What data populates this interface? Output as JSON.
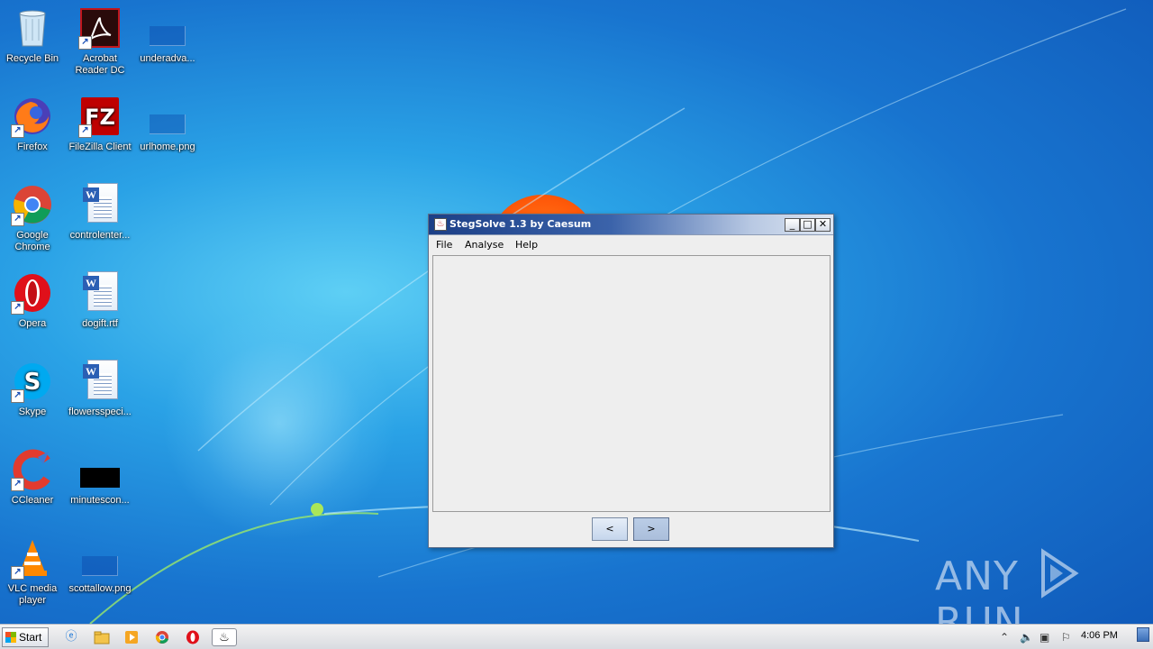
{
  "desktop": {
    "icons": [
      {
        "label": "Recycle Bin",
        "icon": "recycle-bin-icon"
      },
      {
        "label": "Acrobat Reader DC",
        "icon": "acrobat-icon"
      },
      {
        "label": "underadva...",
        "icon": "blank-file-icon"
      },
      {
        "label": "Firefox",
        "icon": "firefox-icon"
      },
      {
        "label": "FileZilla Client",
        "icon": "filezilla-icon"
      },
      {
        "label": "urlhome.png",
        "icon": "png-file-icon"
      },
      {
        "label": "Google Chrome",
        "icon": "chrome-icon"
      },
      {
        "label": "controlenter...",
        "icon": "word-doc-icon"
      },
      {
        "label": "Opera",
        "icon": "opera-icon"
      },
      {
        "label": "dogift.rtf",
        "icon": "word-doc-icon"
      },
      {
        "label": "Skype",
        "icon": "skype-icon"
      },
      {
        "label": "flowersspeci...",
        "icon": "word-doc-icon"
      },
      {
        "label": "CCleaner",
        "icon": "ccleaner-icon"
      },
      {
        "label": "minutescon...",
        "icon": "black-file-icon"
      },
      {
        "label": "VLC media player",
        "icon": "vlc-icon"
      },
      {
        "label": "scottallow.png",
        "icon": "png-file-icon"
      }
    ]
  },
  "window": {
    "title": "StegSolve 1.3 by Caesum",
    "controls": {
      "minimize": "_",
      "maximize": "□",
      "close": "✕"
    },
    "menu": [
      "File",
      "Analyse",
      "Help"
    ],
    "nav": {
      "prev": "<",
      "next": ">"
    }
  },
  "watermark": {
    "text_left": "ANY",
    "text_right": "RUN"
  },
  "taskbar": {
    "start_label": "Start",
    "pinned": [
      "ie-icon",
      "explorer-icon",
      "media-player-icon",
      "chrome-icon",
      "opera-icon",
      "java-app-icon"
    ],
    "clock": "4:06 PM"
  },
  "colors": {
    "title_active": "#1c3f86",
    "desktop_blue": "#1874cf"
  }
}
